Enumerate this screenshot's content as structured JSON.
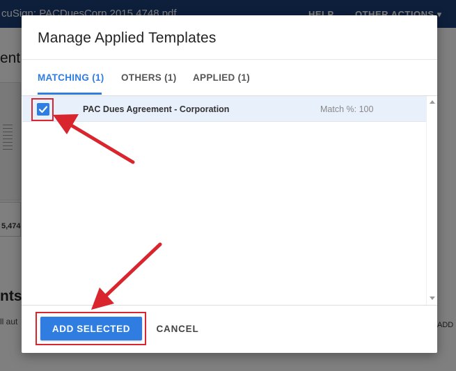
{
  "background": {
    "doc_title": "cuSign: PACDuesCorp 2015 4748.pdf",
    "help": "HELP",
    "other_actions": "OTHER ACTIONS ▾",
    "heading_1": "ent",
    "number": "5,474",
    "heading_2": "nts",
    "subtext": "ll aut",
    "add": "ADD"
  },
  "modal": {
    "title": "Manage Applied Templates",
    "tabs": [
      {
        "label": "MATCHING (1)",
        "active": true
      },
      {
        "label": "OTHERS (1)",
        "active": false
      },
      {
        "label": "APPLIED (1)",
        "active": false
      }
    ],
    "rows": [
      {
        "name": "PAC Dues Agreement - Corporation",
        "match": "Match %: 100",
        "checked": true
      }
    ],
    "buttons": {
      "add_selected": "ADD SELECTED",
      "cancel": "CANCEL"
    }
  },
  "icons": {
    "checkbox": "check-icon",
    "scroll_up": "chevron-up-icon",
    "scroll_down": "chevron-down-icon",
    "annotation": "red-arrow-icon"
  },
  "colors": {
    "accent": "#2f7de1",
    "topbar": "#1c3f78",
    "annotation": "#d9262e",
    "selected_row": "#e8f0fb"
  }
}
